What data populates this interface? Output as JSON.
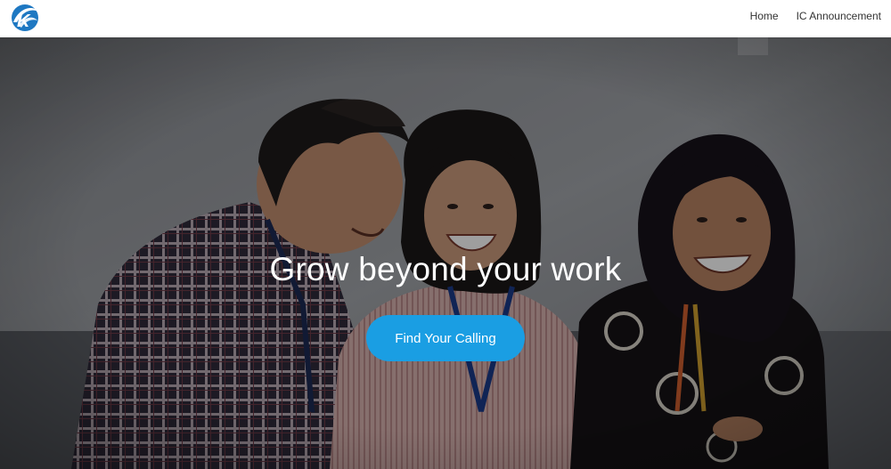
{
  "navbar": {
    "logo_icon": "ic-globe-logo-icon",
    "links": [
      {
        "label": "Home"
      },
      {
        "label": "IC Announcement"
      }
    ]
  },
  "hero": {
    "title": "Grow beyond your work",
    "cta_label": "Find Your Calling",
    "image_icon": "three-colleagues-laughing-photo"
  },
  "colors": {
    "cta": "#1a9ee3",
    "logo_blue": "#1e78c2",
    "overlay": "#000000"
  }
}
